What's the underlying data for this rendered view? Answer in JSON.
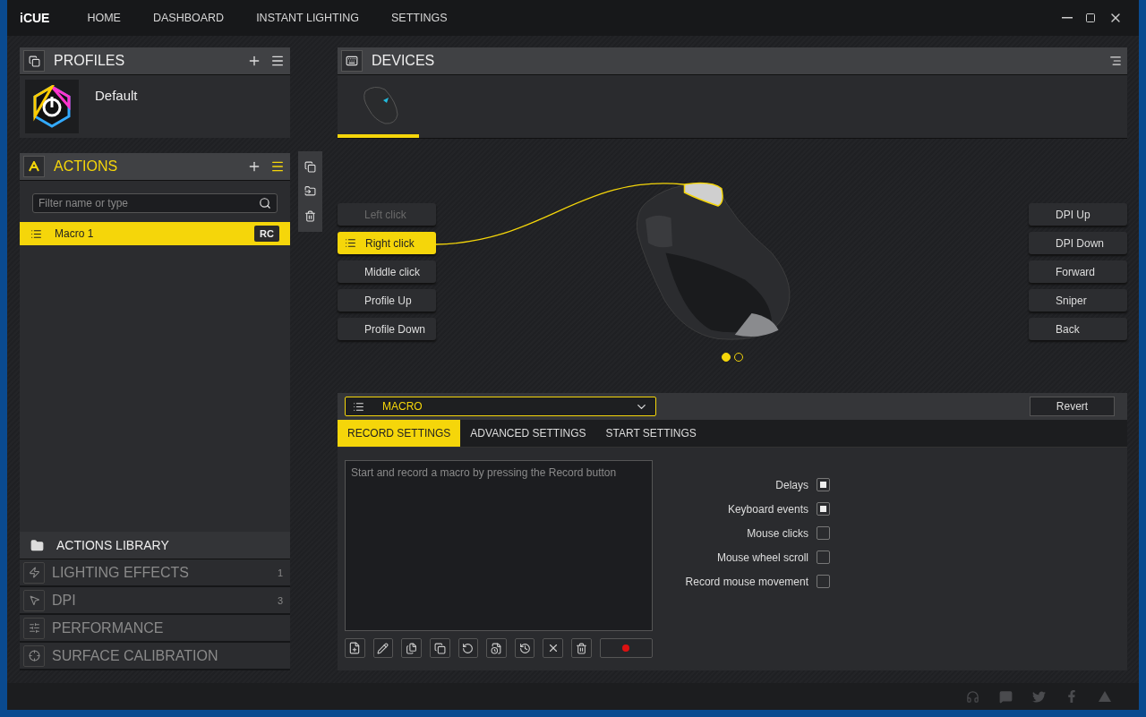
{
  "app": {
    "logo": "iCUE"
  },
  "nav": [
    {
      "label": "HOME"
    },
    {
      "label": "DASHBOARD"
    },
    {
      "label": "INSTANT LIGHTING"
    },
    {
      "label": "SETTINGS"
    }
  ],
  "profiles": {
    "title": "PROFILES",
    "items": [
      {
        "name": "Default"
      }
    ]
  },
  "actions": {
    "title": "ACTIONS",
    "search": {
      "placeholder": "Filter name or type"
    },
    "items": [
      {
        "name": "Macro 1",
        "badge": "RC",
        "selected": true
      }
    ]
  },
  "library": {
    "title": "ACTIONS LIBRARY",
    "sections": [
      {
        "kind": "lighting",
        "label": "LIGHTING EFFECTS",
        "count": "1"
      },
      {
        "kind": "dpi",
        "label": "DPI",
        "count": "3"
      },
      {
        "kind": "performance",
        "label": "PERFORMANCE"
      },
      {
        "kind": "calibration",
        "label": "SURFACE CALIBRATION"
      }
    ]
  },
  "devices": {
    "title": "DEVICES",
    "tabs": [
      {
        "selected": true
      }
    ]
  },
  "buttons_left": [
    {
      "label": "Left click",
      "disabled": true,
      "selected": false
    },
    {
      "label": "Right click",
      "disabled": false,
      "selected": true
    },
    {
      "label": "Middle click",
      "disabled": false,
      "selected": false
    },
    {
      "label": "Profile Up",
      "disabled": false,
      "selected": false
    },
    {
      "label": "Profile Down",
      "disabled": false,
      "selected": false
    }
  ],
  "buttons_right": [
    {
      "label": "DPI Up",
      "disabled": false,
      "selected": false
    },
    {
      "label": "DPI Down",
      "disabled": false,
      "selected": false
    },
    {
      "label": "Forward",
      "disabled": false,
      "selected": false
    },
    {
      "label": "Sniper",
      "disabled": false,
      "selected": false
    },
    {
      "label": "Back",
      "disabled": false,
      "selected": false
    }
  ],
  "pager": [
    {
      "selected": true
    },
    {
      "selected": false
    }
  ],
  "action_type": {
    "value": "MACRO"
  },
  "revert": "Revert",
  "tabs": [
    {
      "label": "RECORD SETTINGS",
      "selected": true
    },
    {
      "label": "ADVANCED SETTINGS",
      "selected": false
    },
    {
      "label": "START SETTINGS",
      "selected": false
    }
  ],
  "macro_editor": {
    "placeholder": "Start and record a macro by pressing the Record button"
  },
  "options": [
    {
      "label": "Delays",
      "checked": true
    },
    {
      "label": "Keyboard events",
      "checked": true
    },
    {
      "label": "Mouse clicks",
      "checked": false
    },
    {
      "label": "Mouse wheel scroll",
      "checked": false
    },
    {
      "label": "Record mouse movement",
      "checked": false
    }
  ]
}
